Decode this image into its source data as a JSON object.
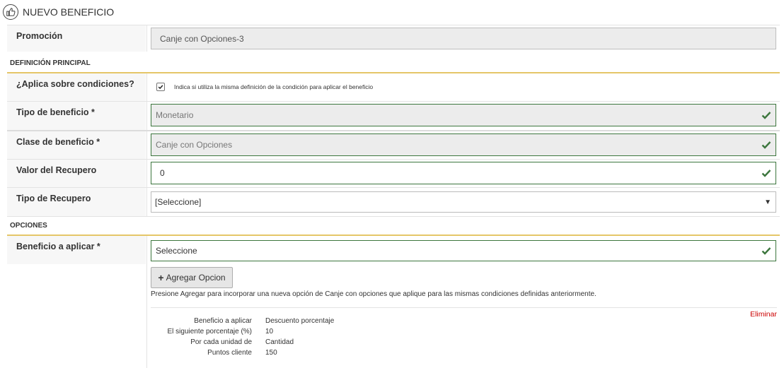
{
  "header": {
    "title": "NUEVO BENEFICIO",
    "icon": "thumbs-up-icon"
  },
  "promocion": {
    "label": "Promoción",
    "value": "Canje con Opciones-3"
  },
  "section_principal": "DEFINICIÓN PRINCIPAL",
  "aplica": {
    "label": "¿Aplica sobre condiciones?",
    "checked": true,
    "hint": "Indica si utiliza la misma definición de la condición para aplicar el beneficio"
  },
  "tipo_beneficio": {
    "label": "Tipo de beneficio *",
    "value": "Monetario"
  },
  "clase_beneficio": {
    "label": "Clase de beneficio *",
    "value": "Canje con Opciones"
  },
  "valor_recupero": {
    "label": "Valor del Recupero",
    "value": "0"
  },
  "tipo_recupero": {
    "label": "Tipo de Recupero",
    "value": "[Seleccione]"
  },
  "section_opciones": "OPCIONES",
  "beneficio_aplicar": {
    "label": "Beneficio a aplicar *",
    "value": "Seleccione"
  },
  "add_button": {
    "label": "Agregar Opcion"
  },
  "help_text": "Presione Agregar para incorporar una nueva opción de Canje con opciones que aplique para las mismas condiciones definidas anteriormente.",
  "option": {
    "delete_label": "Eliminar",
    "rows": [
      {
        "key": "Beneficio a aplicar",
        "value": "Descuento porcentaje"
      },
      {
        "key": "El siguiente porcentaje (%)",
        "value": "10"
      },
      {
        "key": "Por cada unidad de",
        "value": "Cantidad"
      },
      {
        "key": "Puntos cliente",
        "value": "150"
      }
    ]
  },
  "colors": {
    "accent_line": "#e5c668",
    "valid": "#3c763d",
    "danger": "#cc0000"
  }
}
